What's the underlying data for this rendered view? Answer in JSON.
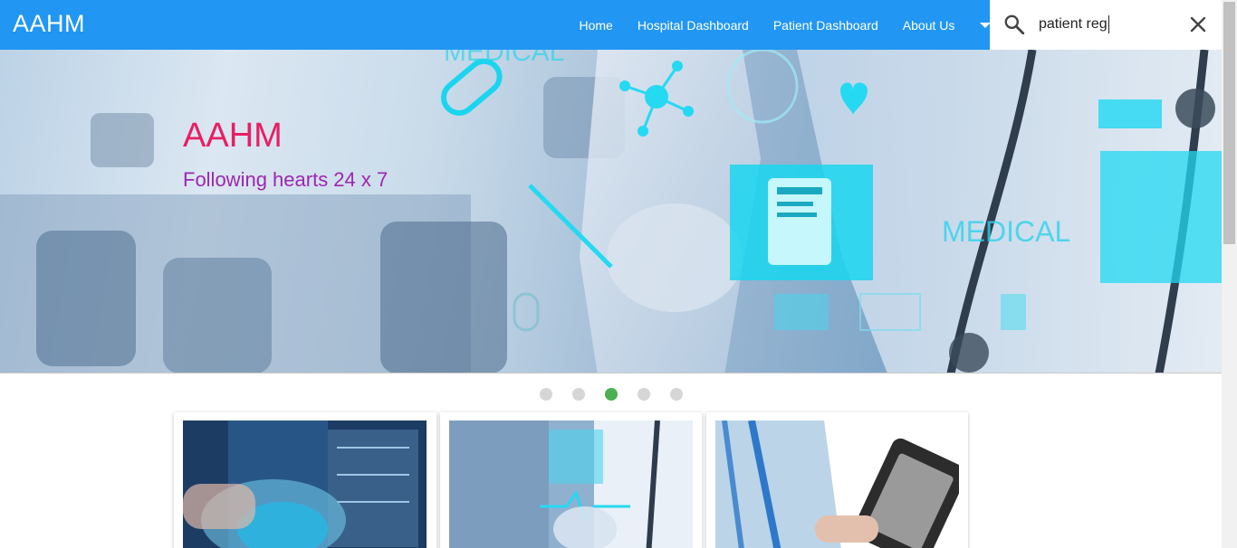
{
  "brand": "AAHM",
  "nav": {
    "links": [
      "Home",
      "Hospital Dashboard",
      "Patient Dashboard",
      "About Us"
    ]
  },
  "search": {
    "value": "patient reg"
  },
  "hero": {
    "title": "AAHM",
    "subtitle": "Following hearts 24 x 7",
    "slide_index": 3,
    "slide_count": 5
  },
  "colors": {
    "navbar": "#2196f3",
    "hero_title": "#e91e63",
    "hero_subtitle": "#9c27b0",
    "active_dot": "#4caf50",
    "inactive_dot": "#d6d6d6"
  },
  "icons": {
    "search": "search-icon",
    "close": "close-icon",
    "dropdown": "dropdown-caret-icon"
  }
}
